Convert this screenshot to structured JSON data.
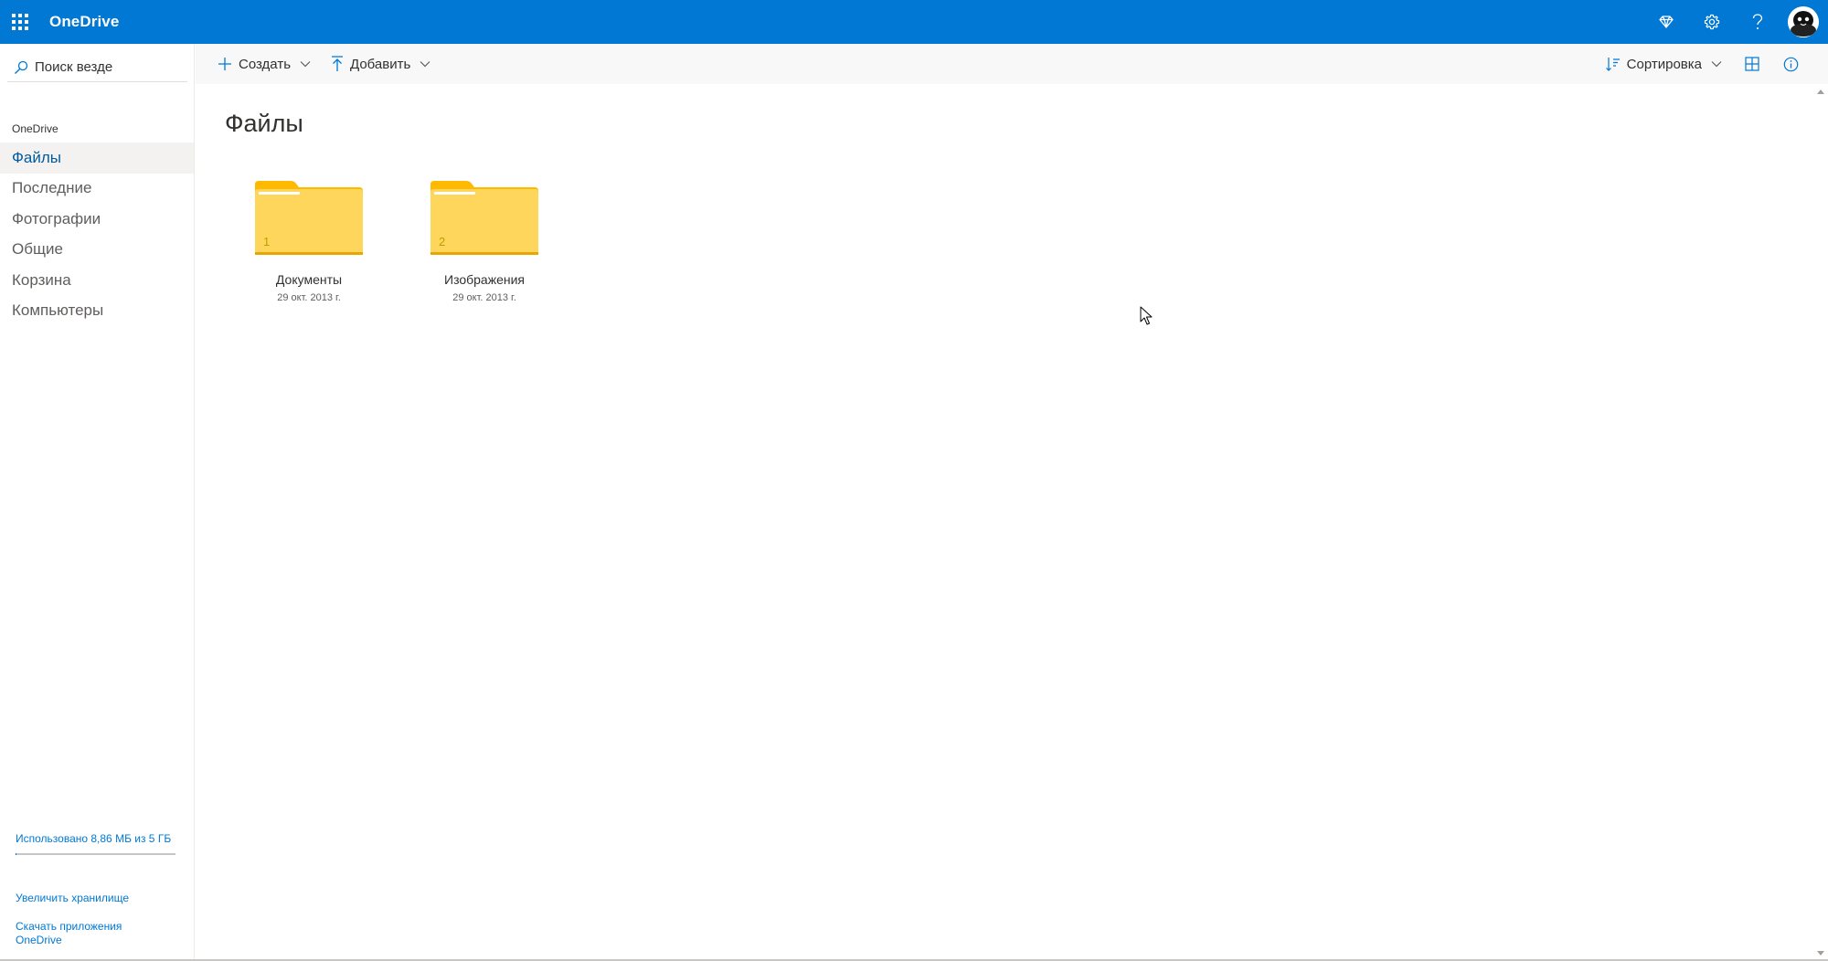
{
  "topbar": {
    "app_name": "OneDrive",
    "icons": [
      "app-launcher-icon",
      "premium-diamond-icon",
      "settings-gear-icon",
      "help-icon",
      "user-avatar"
    ],
    "accent": "#0078d4"
  },
  "sidebar": {
    "search_placeholder": "Поиск везде",
    "section_label": "OneDrive",
    "items": [
      {
        "label": "Файлы",
        "active": true
      },
      {
        "label": "Последние",
        "active": false
      },
      {
        "label": "Фотографии",
        "active": false
      },
      {
        "label": "Общие",
        "active": false
      },
      {
        "label": "Корзина",
        "active": false
      },
      {
        "label": "Компьютеры",
        "active": false
      }
    ],
    "storage_text": "Использовано 8,86 МБ из 5 ГБ",
    "storage_used_fraction": 0.0017,
    "upgrade_link": "Увеличить хранилище",
    "apps_link": "Скачать приложения OneDrive"
  },
  "commandbar": {
    "new_label": "Создать",
    "upload_label": "Добавить",
    "sort_label": "Сортировка"
  },
  "main": {
    "title": "Файлы",
    "folders": [
      {
        "name": "Документы",
        "date": "29 окт. 2013 г.",
        "count": "1"
      },
      {
        "name": "Изображения",
        "date": "29 окт. 2013 г.",
        "count": "2"
      }
    ],
    "folder_colors": {
      "body": "#ffd65c",
      "tab": "#ffb900",
      "shadow": "#e8a700"
    }
  }
}
